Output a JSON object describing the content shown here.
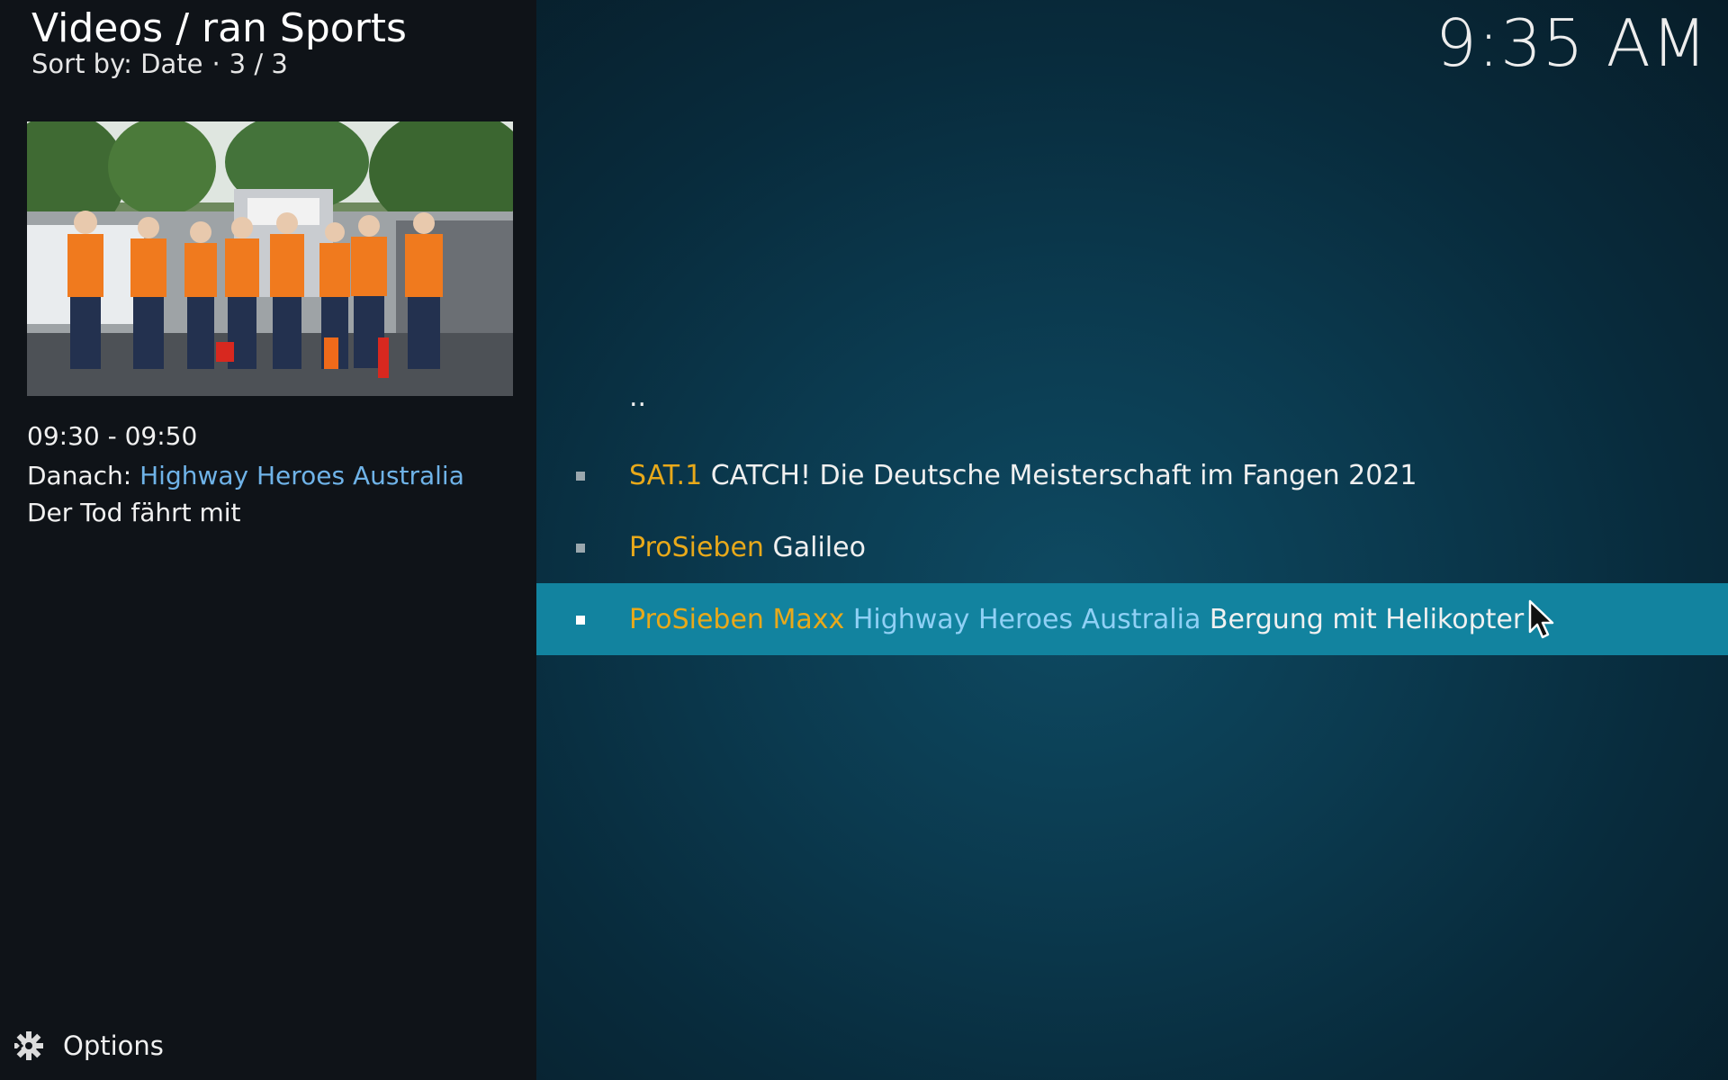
{
  "header": {
    "title": "Videos / ran Sports",
    "sort_label": "Sort by: Date",
    "separator": "·",
    "position": "3 / 3"
  },
  "clock": "9:35 AM",
  "info": {
    "time_range": "09:30 - 09:50",
    "next_prefix": "Danach:",
    "next_show": "Highway Heroes Australia",
    "next_episode": "Der Tod fährt mit"
  },
  "list": {
    "parent": "..",
    "items": [
      {
        "channel": "SAT.1",
        "show": "",
        "title": "CATCH! Die Deutsche Meisterschaft im Fangen 2021"
      },
      {
        "channel": "ProSieben",
        "show": "",
        "title": "Galileo"
      },
      {
        "channel": "ProSieben Maxx",
        "show": "Highway Heroes Australia",
        "title": "Bergung mit Helikopter"
      }
    ]
  },
  "options": {
    "label": "Options",
    "icon": "gear-icon"
  },
  "colors": {
    "channel": "#e8a91a",
    "show": "#6fb3e8",
    "focus": "#12839f"
  }
}
